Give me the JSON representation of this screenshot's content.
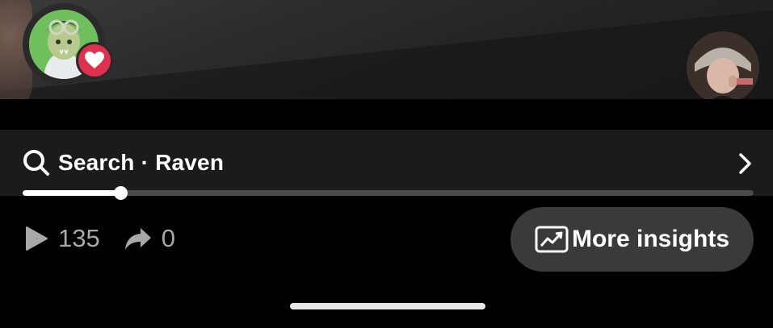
{
  "search": {
    "prefix": "Search",
    "separator": "·",
    "query": "Raven"
  },
  "progress": {
    "fraction": 0.134
  },
  "stats": {
    "plays": "135",
    "shares": "0"
  },
  "insights_button": {
    "label": "More insights"
  },
  "icons": {
    "search": "search-icon",
    "chevron": "chevron-right-icon",
    "play": "play-icon",
    "share": "share-icon",
    "insights": "chart-icon",
    "heart": "heart-icon"
  },
  "colors": {
    "badge": "#e0304f",
    "button_bg": "#3a3a3a",
    "stat_text": "#a8a8a8"
  }
}
